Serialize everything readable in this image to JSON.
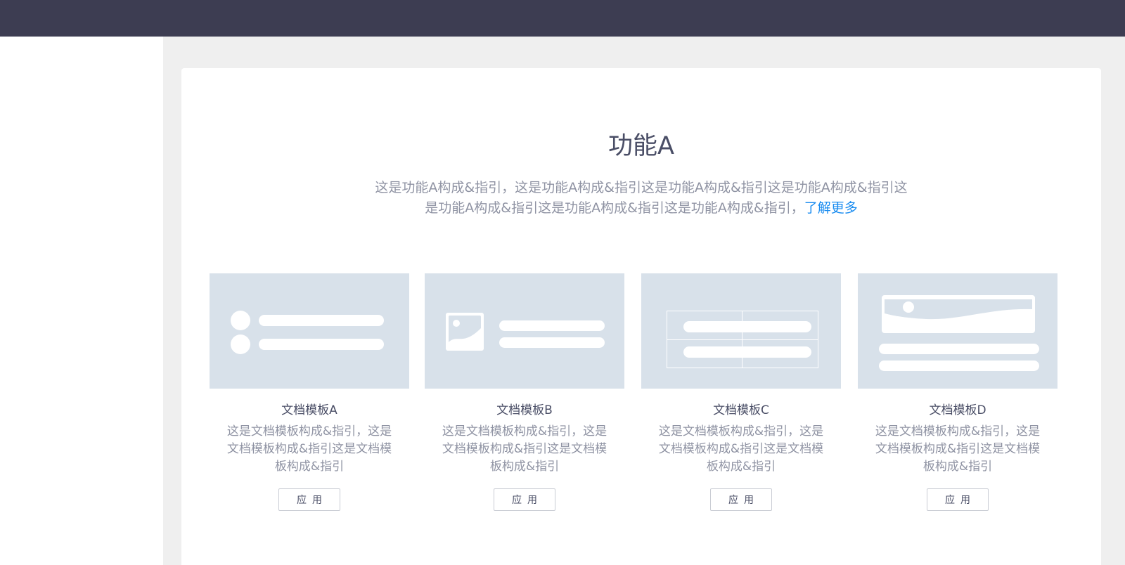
{
  "feature": {
    "title": "功能A",
    "desc_line1": "这是功能A构成&指引，这是功能A构成&指引这是功能A构成&指引这是功能A构成&指引这",
    "desc_line2": "是功能A构成&指引这是功能A构成&指引这是功能A构成&指引，",
    "learn_more": "了解更多"
  },
  "templates": [
    {
      "name": "文档模板A",
      "desc": "这是文档模板构成&指引，这是文档模板构成&指引这是文档模板构成&指引",
      "apply": "应用",
      "icon": "list-template-icon"
    },
    {
      "name": "文档模板B",
      "desc": "这是文档模板构成&指引，这是文档模板构成&指引这是文档模板构成&指引",
      "apply": "应用",
      "icon": "image-text-template-icon"
    },
    {
      "name": "文档模板C",
      "desc": "这是文档模板构成&指引，这是文档模板构成&指引这是文档模板构成&指引",
      "apply": "应用",
      "icon": "table-template-icon"
    },
    {
      "name": "文档模板D",
      "desc": "这是文档模板构成&指引，这是文档模板构成&指引这是文档模板构成&指引",
      "apply": "应用",
      "icon": "banner-template-icon"
    }
  ],
  "colors": {
    "topbar": "#3d3d52",
    "accent": "#1a8cf0",
    "thumb_bg": "#d8e1ea"
  }
}
